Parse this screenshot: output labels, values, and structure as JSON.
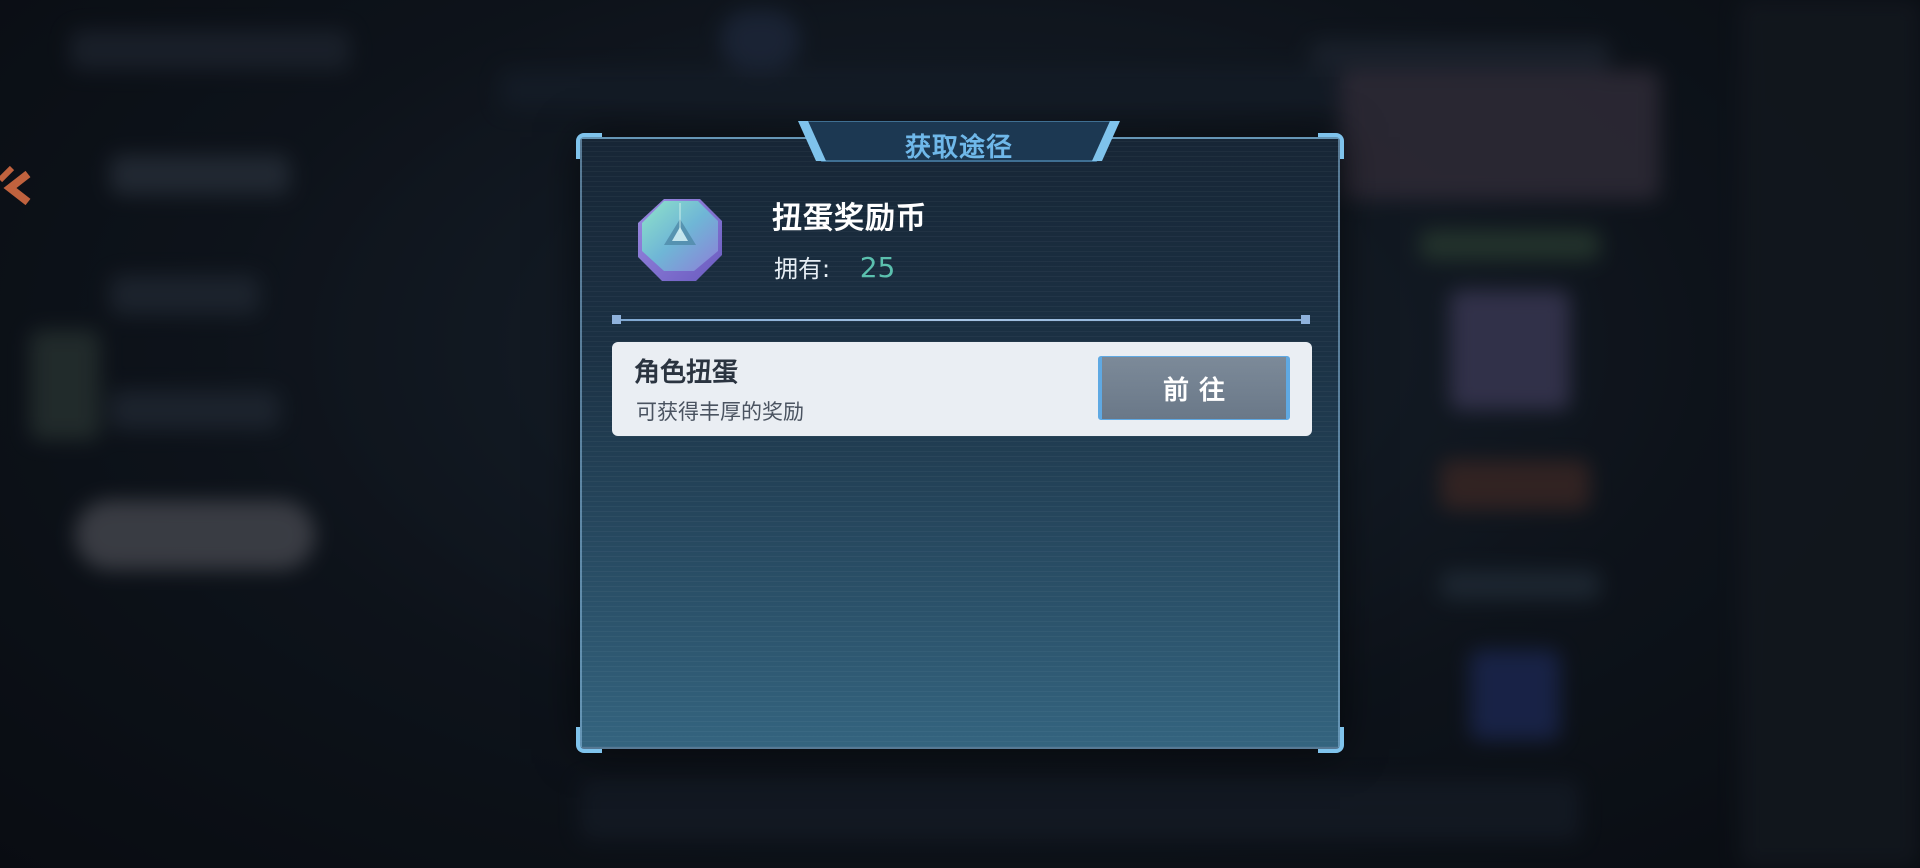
{
  "dialog": {
    "title": "获取途径",
    "item": {
      "name": "扭蛋奖励币",
      "icon": "gacha-coin-gem-icon",
      "owned_label": "拥有:",
      "owned_value": "25"
    },
    "sources": [
      {
        "name": "角色扭蛋",
        "description": "可获得丰厚的奖励",
        "button_label": "前往"
      }
    ]
  },
  "colors": {
    "title": "#6fb8ea",
    "owned_value": "#5bc0ae",
    "frame_accent": "#7fc3ec",
    "card_bg": "#eaeef3"
  }
}
